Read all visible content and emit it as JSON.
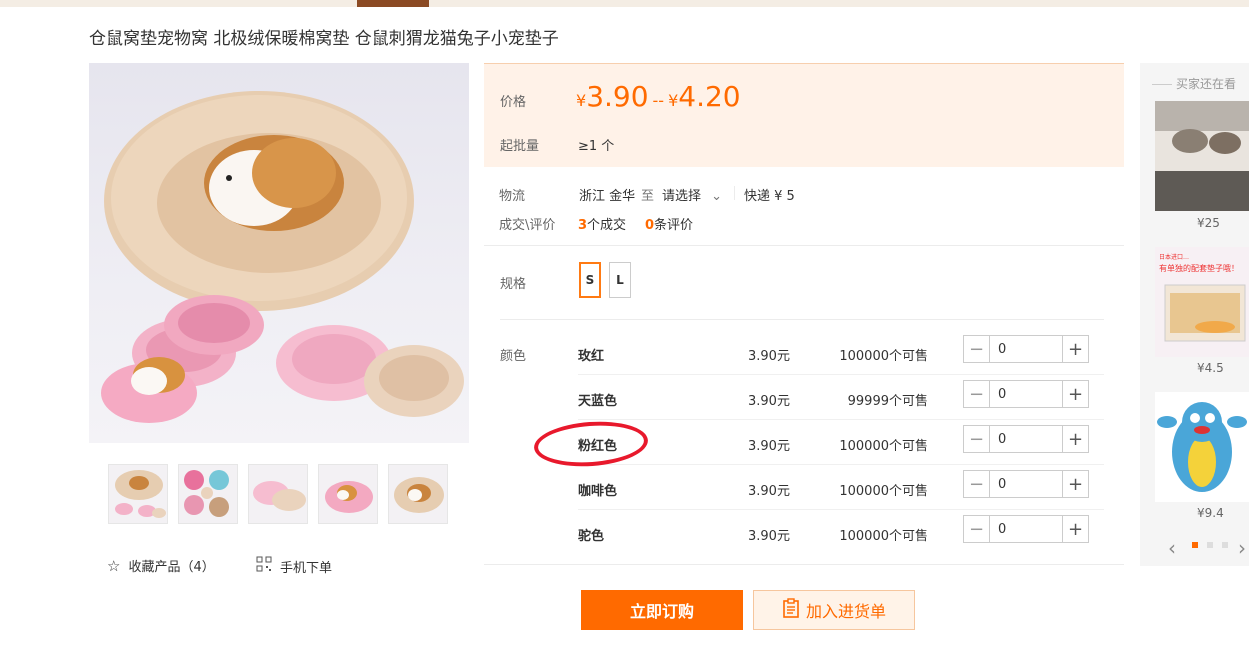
{
  "product": {
    "title": "仓鼠窝垫宠物窝 北极绒保暖棉窝垫 仓鼠刺猬龙猫兔子小宠垫子"
  },
  "actions": {
    "favorite_label": "收藏产品（4）",
    "mobile_order_label": "手机下单"
  },
  "price_box": {
    "price_label": "价格",
    "currency": "¥",
    "price_min": "3.90",
    "range_sep": "--",
    "price_max": "4.20",
    "moq_label": "起批量",
    "moq_value": "≥1 个"
  },
  "logistics": {
    "label": "物流",
    "origin": "浙江 金华",
    "to": "至",
    "destination_placeholder": "请选择",
    "express": "快递 ¥ 5"
  },
  "deals": {
    "label": "成交\\评价",
    "deal_count": "3",
    "deal_suffix": "个成交",
    "review_count": "0",
    "review_suffix": "条评价"
  },
  "spec": {
    "label": "规格",
    "options": [
      "S",
      "L"
    ],
    "selected": "S"
  },
  "color": {
    "label": "颜色",
    "rows": [
      {
        "name": "玫红",
        "price": "3.90元",
        "stock": "100000个可售",
        "qty": "0"
      },
      {
        "name": "天蓝色",
        "price": "3.90元",
        "stock": "99999个可售",
        "qty": "0"
      },
      {
        "name": "粉红色",
        "price": "3.90元",
        "stock": "100000个可售",
        "qty": "0"
      },
      {
        "name": "咖啡色",
        "price": "3.90元",
        "stock": "100000个可售",
        "qty": "0"
      },
      {
        "name": "驼色",
        "price": "3.90元",
        "stock": "100000个可售",
        "qty": "0"
      }
    ],
    "highlighted": "粉红色"
  },
  "buttons": {
    "order": "立即订购",
    "add_to_list": "加入进货单"
  },
  "sidebar": {
    "title": "买家还在看",
    "items": [
      {
        "price": "¥25"
      },
      {
        "price": "¥4.5",
        "banner_text": "日本进口…有单独的配套垫子哦！"
      },
      {
        "price": "¥9.4"
      }
    ]
  },
  "colors": {
    "accent": "#ff6a00",
    "highlight_circle": "#e8192c",
    "price_bg": "#fff2e8"
  }
}
